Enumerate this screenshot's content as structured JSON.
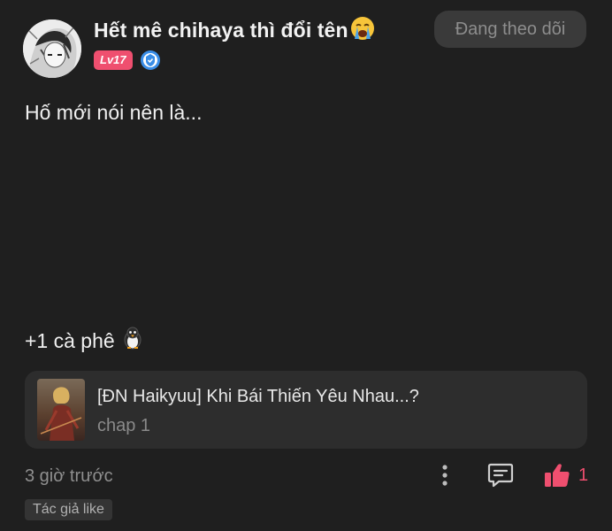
{
  "user": {
    "name": "Hết mê chihaya thì đổi tên",
    "name_emoji": "crying-face",
    "level": "Lv17",
    "verified_icon": "blue-shield-check-icon"
  },
  "follow_button": {
    "label": "Đang theo dõi"
  },
  "comment": {
    "text": "Hố mới nói nên là...",
    "reward": "+1 cà phê",
    "reward_icon": "penguin-icon"
  },
  "story": {
    "title": "[ĐN Haikyuu] Khi Bái Thiến Yêu Nhau...?",
    "chapter": "chap 1"
  },
  "footer": {
    "time": "3 giờ trước",
    "like_count": "1",
    "author_like_tag": "Tác giả like"
  },
  "colors": {
    "background": "#1f1f1f",
    "accent_pink": "#ef4f6f",
    "card": "#2d2d2d"
  }
}
